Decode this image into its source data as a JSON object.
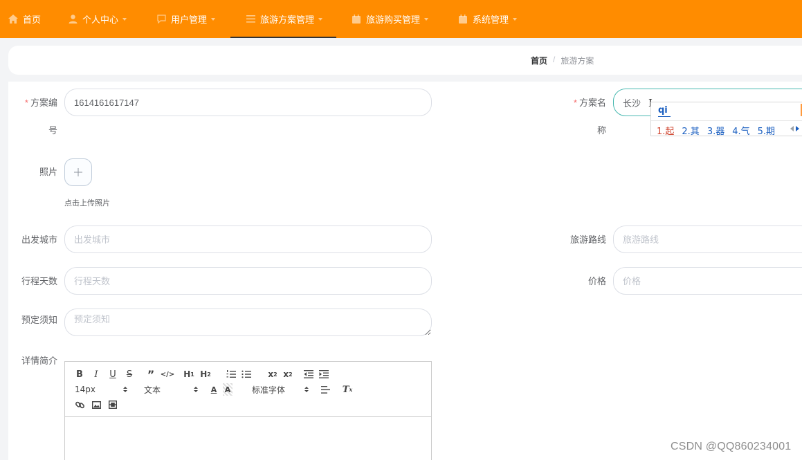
{
  "nav": {
    "items": [
      {
        "label": "首页",
        "icon": "home-icon"
      },
      {
        "label": "个人中心",
        "icon": "user-icon"
      },
      {
        "label": "用户管理",
        "icon": "chat-icon"
      },
      {
        "label": "旅游方案管理",
        "icon": "menu-icon",
        "active": true
      },
      {
        "label": "旅游购买管理",
        "icon": "calendar-icon"
      },
      {
        "label": "系统管理",
        "icon": "calendar-icon"
      }
    ]
  },
  "breadcrumb": {
    "home": "首页",
    "separator": "/",
    "current": "旅游方案"
  },
  "form": {
    "plan_no": {
      "label": "方案编号",
      "label_a": "方案编",
      "label_b": "号",
      "value": "1614161617147"
    },
    "plan_name": {
      "label": "方案名称",
      "label_a": "方案名",
      "label_b": "称",
      "value": "长沙"
    },
    "photo": {
      "label": "照片",
      "tip": "点击上传照片"
    },
    "departure": {
      "label": "出发城市",
      "placeholder": "出发城市"
    },
    "route": {
      "label": "旅游路线",
      "placeholder": "旅游路线"
    },
    "days": {
      "label": "行程天数",
      "placeholder": "行程天数"
    },
    "price": {
      "label": "价格",
      "placeholder": "价格"
    },
    "notice": {
      "label": "预定须知",
      "placeholder": "预定须知"
    },
    "detail": {
      "label": "详情简介"
    },
    "required_mark": "*"
  },
  "editor": {
    "font_size": "14px",
    "text_style": "文本",
    "font_family": "标准字体"
  },
  "ime": {
    "composition": "qi",
    "candidates": [
      "1.起",
      "2.其",
      "3.器",
      "4.气",
      "5.期"
    ]
  },
  "watermark": "CSDN @QQ860234001",
  "colors": {
    "nav_bg": "#ff8c00",
    "focus_border": "#48b8b0",
    "required": "#f56c6c"
  }
}
